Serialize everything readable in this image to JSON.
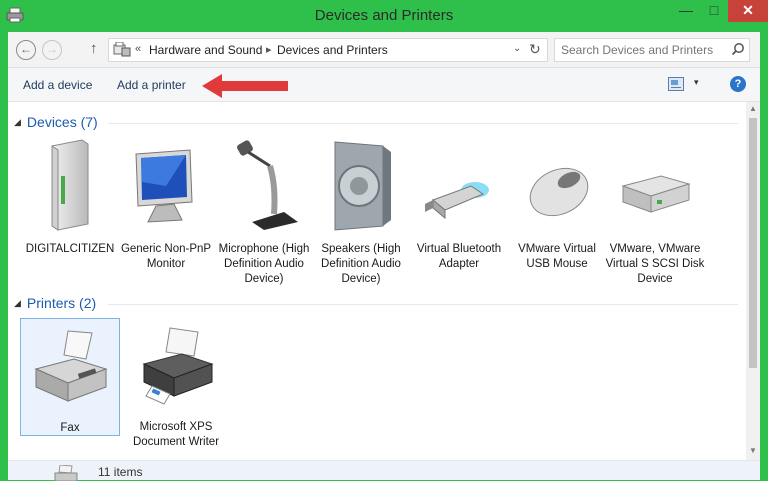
{
  "window": {
    "title": "Devices and Printers",
    "minimize_glyph": "—",
    "maximize_glyph": "□",
    "close_glyph": "✕"
  },
  "address": {
    "back_glyph": "←",
    "forward_glyph": "→",
    "up_glyph": "↑",
    "overflow_glyph": "«",
    "crumbs": [
      "Hardware and Sound",
      "Devices and Printers"
    ],
    "separator_glyph": "▸",
    "dropdown_glyph": "⌄",
    "refresh_glyph": "↻",
    "search_placeholder": "Search Devices and Printers"
  },
  "toolbar": {
    "add_device_label": "Add a device",
    "add_printer_label": "Add a printer",
    "view_dropdown_glyph": "▾",
    "help_glyph": "?"
  },
  "groups": {
    "devices": {
      "label": "Devices (7)",
      "items": [
        {
          "label": "DIGITALCITIZEN",
          "icon": "computer-tower-icon"
        },
        {
          "label": "Generic Non-PnP Monitor",
          "icon": "monitor-icon"
        },
        {
          "label": "Microphone (High Definition Audio Device)",
          "icon": "microphone-icon"
        },
        {
          "label": "Speakers (High Definition Audio Device)",
          "icon": "speaker-icon"
        },
        {
          "label": "Virtual Bluetooth Adapter",
          "icon": "bluetooth-adapter-icon"
        },
        {
          "label": "VMware Virtual USB Mouse",
          "icon": "mouse-icon"
        },
        {
          "label": "VMware, VMware Virtual S SCSI Disk Device",
          "icon": "disk-drive-icon"
        }
      ]
    },
    "printers": {
      "label": "Printers (2)",
      "items": [
        {
          "label": "Fax",
          "icon": "fax-icon",
          "selected": true
        },
        {
          "label": "Microsoft XPS Document Writer",
          "icon": "printer-icon"
        }
      ]
    }
  },
  "status": {
    "text": "11 items"
  },
  "colors": {
    "window_frame": "#2ec04a",
    "close_button": "#c7433a",
    "group_header": "#1e5bb0",
    "annotation_arrow": "#e03a3a"
  }
}
